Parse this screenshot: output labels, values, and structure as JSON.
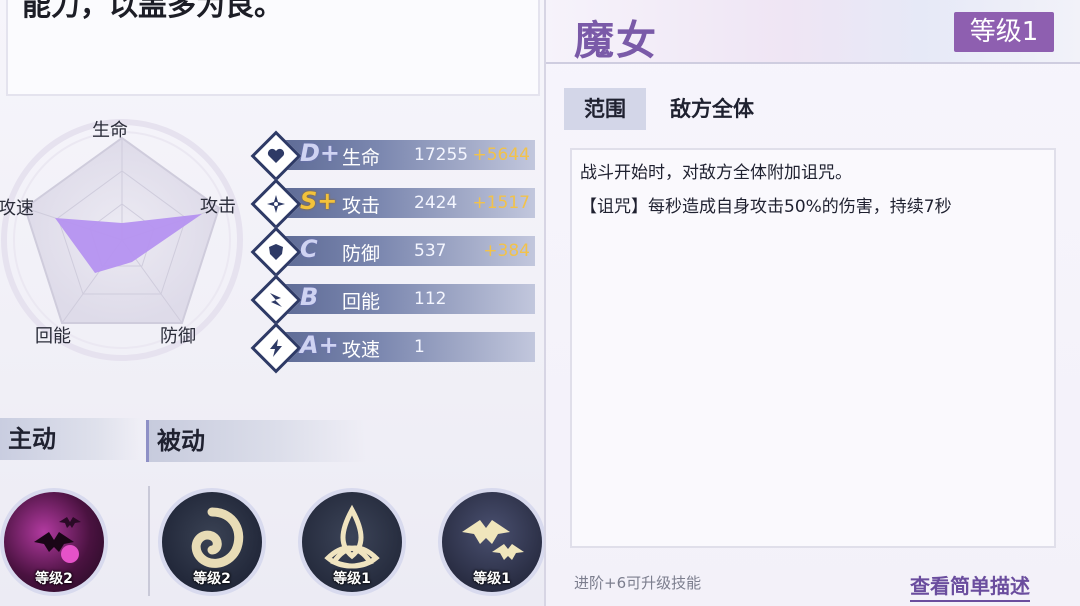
{
  "description": {
    "text": "能力，以盖多为良。"
  },
  "radar": {
    "labels": {
      "hp": "生命",
      "attack": "攻击",
      "defense": "防御",
      "regen": "回能",
      "speed": "攻速"
    }
  },
  "stats": [
    {
      "grade": "D+",
      "name": "生命",
      "value": "17255",
      "bonus": "+5644",
      "icon": "heart-icon"
    },
    {
      "grade": "S+",
      "name": "攻击",
      "value": "2424",
      "bonus": "+1517",
      "icon": "shuriken-icon"
    },
    {
      "grade": "C",
      "name": "防御",
      "value": "537",
      "bonus": "+384",
      "icon": "shield-icon"
    },
    {
      "grade": "B",
      "name": "回能",
      "value": "112",
      "bonus": "",
      "icon": "energy-icon"
    },
    {
      "grade": "A+",
      "name": "攻速",
      "value": "1",
      "bonus": "",
      "icon": "lightning-icon"
    }
  ],
  "tabs": {
    "active": "主动",
    "passive": "被动"
  },
  "skills": [
    {
      "level": "等级2",
      "icon": "bat-swarm-icon"
    },
    {
      "level": "等级2",
      "icon": "spiral-icon"
    },
    {
      "level": "等级1",
      "icon": "triquetra-icon"
    },
    {
      "level": "等级1",
      "icon": "bats-icon"
    }
  ],
  "panel": {
    "title": "魔女",
    "level": "等级1",
    "range_label": "范围",
    "range_value": "敌方全体",
    "desc_line1": "战斗开始时，对敌方全体附加诅咒。",
    "desc_line2": "【诅咒】每秒造成自身攻击50%的伤害，持续7秒",
    "hint": "进阶+6可升级技能",
    "link": "查看简单描述"
  },
  "colors": {
    "accent": "#8e5fb0",
    "radar_fill": "#b592f0",
    "bonus": "#f2c24a"
  }
}
